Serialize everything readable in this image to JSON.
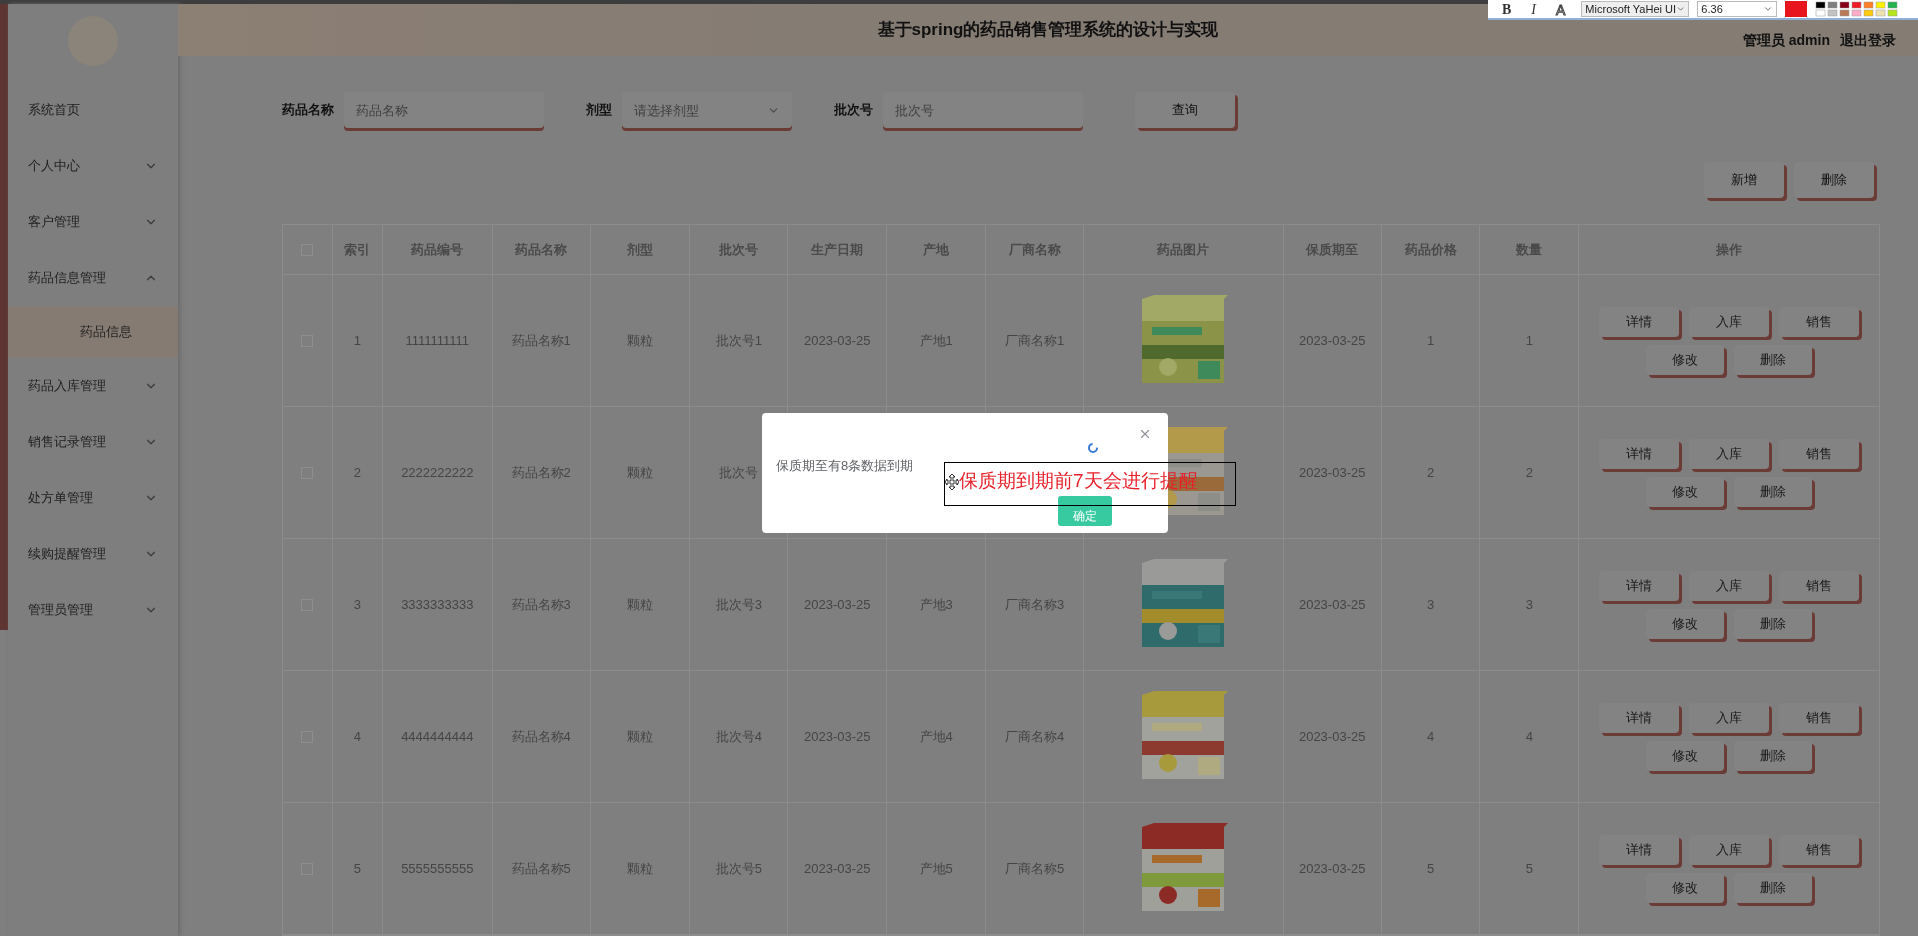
{
  "header": {
    "title": "基于spring的药品销售管理系统的设计与实现",
    "user_label": "管理员 admin",
    "logout": "退出登录"
  },
  "toolbar": {
    "bold": "B",
    "italic": "I",
    "outline": "A",
    "font": "Microsoft YaHei UI",
    "size": "6.36"
  },
  "sidebar": {
    "items": [
      {
        "label": "系统首页",
        "kind": "link"
      },
      {
        "label": "个人中心",
        "kind": "menu",
        "expanded": false
      },
      {
        "label": "客户管理",
        "kind": "menu",
        "expanded": false
      },
      {
        "label": "药品信息管理",
        "kind": "menu",
        "expanded": true,
        "children": [
          {
            "label": "药品信息",
            "selected": true
          }
        ]
      },
      {
        "label": "药品入库管理",
        "kind": "menu",
        "expanded": false
      },
      {
        "label": "销售记录管理",
        "kind": "menu",
        "expanded": false
      },
      {
        "label": "处方单管理",
        "kind": "menu",
        "expanded": false
      },
      {
        "label": "续购提醒管理",
        "kind": "menu",
        "expanded": false
      },
      {
        "label": "管理员管理",
        "kind": "menu",
        "expanded": false
      }
    ]
  },
  "filters": [
    {
      "label": "药品名称",
      "kind": "input",
      "placeholder": "药品名称"
    },
    {
      "label": "剂型",
      "kind": "select",
      "placeholder": "请选择剂型"
    },
    {
      "label": "批次号",
      "kind": "input",
      "placeholder": "批次号"
    }
  ],
  "search_button": "查询",
  "actions": [
    "新增",
    "删除"
  ],
  "table": {
    "select_all_checked": false,
    "columns": [
      "索引",
      "药品编号",
      "药品名称",
      "剂型",
      "批次号",
      "生产日期",
      "产地",
      "厂商名称",
      "药品图片",
      "保质期至",
      "药品价格",
      "数量",
      "操作"
    ],
    "rows": [
      {
        "checked": false,
        "index": "1",
        "code": "1111111111",
        "name": "药品名称1",
        "form": "颗粒",
        "batch": "批次号1",
        "produced": "2023-03-25",
        "origin": "产地1",
        "maker": "厂商名称1",
        "expiry": "2023-03-25",
        "price": "1",
        "quantity": "1",
        "buttons": [
          "详情",
          "入库",
          "销售",
          "修改",
          "删除"
        ]
      },
      {
        "checked": false,
        "index": "2",
        "code": "2222222222",
        "name": "药品名称2",
        "form": "颗粒",
        "batch": "批次号",
        "expiry": "2023-03-25",
        "price": "2",
        "quantity": "2",
        "buttons": [
          "详情",
          "入库",
          "销售",
          "修改",
          "删除"
        ]
      },
      {
        "checked": false,
        "index": "3",
        "code": "3333333333",
        "name": "药品名称3",
        "form": "颗粒",
        "batch": "批次号3",
        "produced": "2023-03-25",
        "origin": "产地3",
        "maker": "厂商名称3",
        "expiry": "2023-03-25",
        "price": "3",
        "quantity": "3",
        "buttons": [
          "详情",
          "入库",
          "销售",
          "修改",
          "删除"
        ]
      },
      {
        "checked": false,
        "index": "4",
        "code": "4444444444",
        "name": "药品名称4",
        "form": "颗粒",
        "batch": "批次号4",
        "produced": "2023-03-25",
        "origin": "产地4",
        "maker": "厂商名称4",
        "expiry": "2023-03-25",
        "price": "4",
        "quantity": "4",
        "buttons": [
          "详情",
          "入库",
          "销售",
          "修改",
          "删除"
        ]
      },
      {
        "checked": false,
        "index": "5",
        "code": "5555555555",
        "name": "药品名称5",
        "form": "颗粒",
        "batch": "批次号5",
        "produced": "2023-03-25",
        "origin": "产地5",
        "maker": "厂商名称5",
        "expiry": "2023-03-25",
        "price": "5",
        "quantity": "5",
        "buttons": [
          "详情",
          "入库",
          "销售",
          "修改",
          "删除"
        ]
      }
    ]
  },
  "modal": {
    "message": "保质期至有8条数据到期",
    "confirm": "确定"
  },
  "annotation": {
    "text": "保质期到期前7天会进行提醒"
  }
}
